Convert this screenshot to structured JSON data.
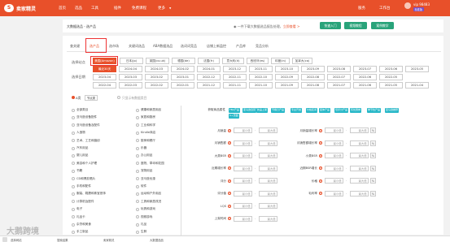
{
  "topbar": {
    "brand": "卖家精灵",
    "nav": [
      "首页",
      "选品",
      "工具",
      "插件",
      "免费课程",
      "更多"
    ],
    "right": [
      "服务",
      "工作台"
    ],
    "user": "vip 98483",
    "badge": "标准版"
  },
  "header": {
    "title": "大数据选品 - 选产品",
    "notice_prefix": "一件下载大数据选品报告处理，",
    "notice_link": "立即查看 >",
    "buttons": [
      "快速入门",
      "视频教程",
      "案例教学"
    ]
  },
  "tabs": [
    "查关键",
    "选产品",
    "选市场",
    "关键词选品",
    "ABA数据选品",
    "选词词竞品",
    "店铺上新监控",
    "产品库",
    "竞品分析"
  ],
  "filters": {
    "site_label": "选择站点",
    "sites": [
      "美国(Amazon)",
      "日本(Jp)",
      "英国(co.uk)",
      "德国(de)",
      "法国(fr)",
      "意大利(it)",
      "西班牙(es)",
      "印度(in)",
      "加拿大(ca)"
    ],
    "date_label": "选择日期",
    "dates_row1": [
      "最近30天",
      "2024-04",
      "2024-03",
      "2024-02",
      "2024-01",
      "2023-12",
      "2023-11",
      "2023-10",
      "2023-09",
      "2023-08",
      "2023-07",
      "2023-06",
      "2023-05"
    ],
    "dates_row2": [
      "2023-04",
      "2023-03",
      "2023-02",
      "2023-01",
      "2022-12",
      "2022-11",
      "2022-10",
      "2022-09",
      "2022-08",
      "2022-07",
      "2022-06",
      "2022-05"
    ],
    "dates_row3": [
      "2022-04",
      "2022-03",
      "2022-02",
      "2022-01",
      "2021-12",
      "2021-11",
      "2021-10",
      "2021-09",
      "2021-08",
      "2021-07",
      "2021-06",
      "2021-05",
      "2021-04"
    ]
  },
  "category": {
    "radio_a": "A类",
    "radio_b": "节点类",
    "check": "只显示有数据类目",
    "left_col": [
      "全部类目",
      "亚马逊设备配件",
      "亚马逊设备及配件",
      "人造物",
      "艺术、工艺和缝纫",
      "汽车用品",
      "婴儿用品",
      "美容和个人护理",
      "书籍",
      "CD和黑胶唱片",
      "手机和配件",
      "服装、鞋履和珠宝首饰",
      "计算机及配件",
      "电子",
      "礼品卡",
      "杂货和美食",
      "手工制品"
    ],
    "right_col": [
      "健康和家居用品",
      "家居和厨房",
      "工业和科学",
      "Kindle商店",
      "厨房和餐厅",
      "乐器",
      "办公用品",
      "庭院、草坪和花园",
      "宠物用品",
      "亚马逊优惠",
      "软件",
      "运动和户外用品",
      "工具和家居改进",
      "玩具和游戏",
      "视频游戏",
      "礼品",
      "生鲜"
    ]
  },
  "tags": [
    "FBA产品",
    "亚马逊自营",
    "新品上架",
    "节假日产品",
    "专业开发",
    "价格区间",
    "变体产品",
    "低评分产品",
    "有优惠券",
    "季节性产品",
    "亚马逊推荐",
    "A+页面"
  ],
  "ranges": {
    "tag_label": "获取商品属性",
    "left": [
      "月销量",
      "月销售额",
      "大类BSR",
      "近期增长率",
      "评分",
      "评分值",
      "LQS",
      "上架时间"
    ],
    "right": [
      "月销量增长率",
      "月销售额增长率",
      "小类BSR",
      "近期BSR增长",
      "价格",
      "毛利率",
      "",
      ""
    ],
    "min": "最小值",
    "max": "最大值"
  },
  "watermark": "大鹅跨境",
  "taskbar": [
    "选择网站",
    "搜索结果",
    "卖家精灵",
    "大数据选品"
  ]
}
